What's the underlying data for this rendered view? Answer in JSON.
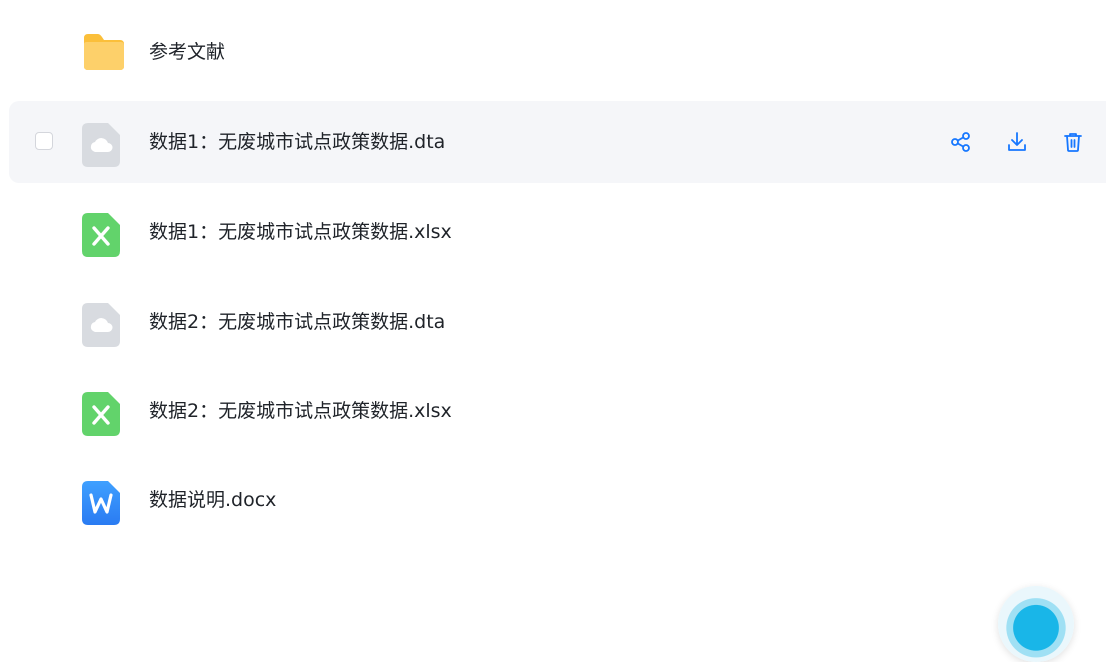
{
  "files": [
    {
      "name": "参考文献",
      "icon": "folder-icon",
      "type": "folder"
    },
    {
      "name": "数据1：无废城市试点政策数据.dta",
      "icon": "cloud-file-icon",
      "type": "dta",
      "hovered": true
    },
    {
      "name": "数据1：无废城市试点政策数据.xlsx",
      "icon": "excel-file-icon",
      "type": "xlsx"
    },
    {
      "name": "数据2：无废城市试点政策数据.dta",
      "icon": "cloud-file-icon",
      "type": "dta"
    },
    {
      "name": "数据2：无废城市试点政策数据.xlsx",
      "icon": "excel-file-icon",
      "type": "xlsx"
    },
    {
      "name": "数据说明.docx",
      "icon": "word-file-icon",
      "type": "docx"
    }
  ],
  "actions": [
    {
      "icon": "share-icon"
    },
    {
      "icon": "download-icon"
    },
    {
      "icon": "delete-icon"
    }
  ],
  "colors": {
    "accent": "#1677ff",
    "hover_bg": "#f5f6f9",
    "folder": "#fcc84f",
    "excel": "#62d36b",
    "word": "#2f8cff",
    "cloud_file": "#d8dbe0",
    "text": "#1f2329"
  }
}
